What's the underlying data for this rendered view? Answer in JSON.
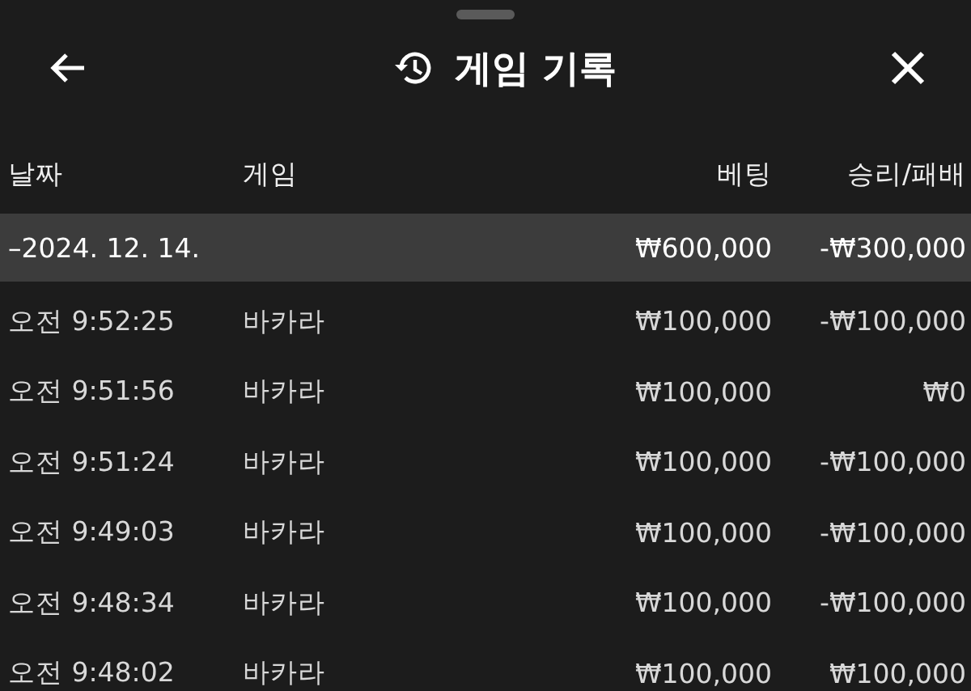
{
  "header": {
    "title": "게임 기록"
  },
  "table": {
    "columns": [
      "날짜",
      "게임",
      "베팅",
      "승리/패배"
    ],
    "group": {
      "date": "–2024. 12. 14.",
      "bet": "₩600,000",
      "result": "-₩300,000"
    },
    "rows": [
      {
        "time": "오전 9:52:25",
        "game": "바카라",
        "bet": "₩100,000",
        "result": "-₩100,000"
      },
      {
        "time": "오전 9:51:56",
        "game": "바카라",
        "bet": "₩100,000",
        "result": "₩0"
      },
      {
        "time": "오전 9:51:24",
        "game": "바카라",
        "bet": "₩100,000",
        "result": "-₩100,000"
      },
      {
        "time": "오전 9:49:03",
        "game": "바카라",
        "bet": "₩100,000",
        "result": "-₩100,000"
      },
      {
        "time": "오전 9:48:34",
        "game": "바카라",
        "bet": "₩100,000",
        "result": "-₩100,000"
      },
      {
        "time": "오전 9:48:02",
        "game": "바카라",
        "bet": "₩100,000",
        "result": "₩100,000"
      }
    ]
  }
}
